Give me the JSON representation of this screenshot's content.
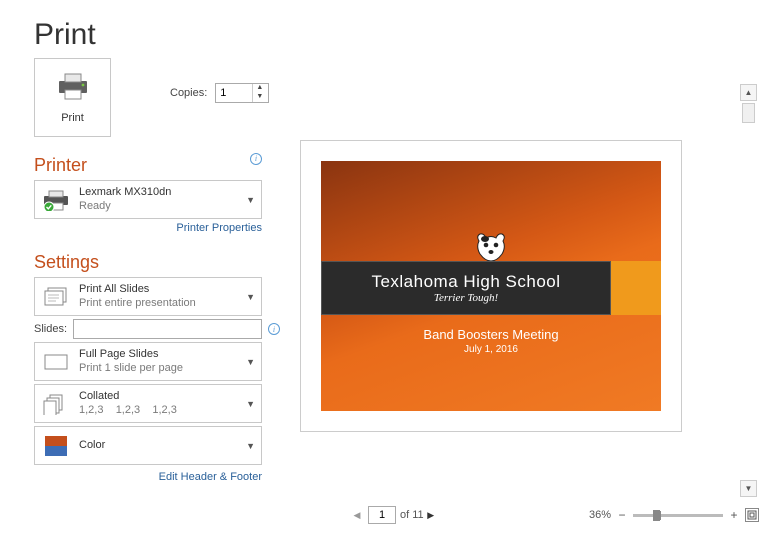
{
  "page_title": "Print",
  "print_tile": {
    "label": "Print"
  },
  "copies": {
    "label": "Copies:",
    "value": "1"
  },
  "sections": {
    "printer": "Printer",
    "settings": "Settings"
  },
  "printer": {
    "name": "Lexmark MX310dn",
    "status": "Ready",
    "properties_link": "Printer Properties"
  },
  "settings": {
    "what": {
      "main": "Print All Slides",
      "sub": "Print entire presentation"
    },
    "slides_label": "Slides:",
    "slides_value": "",
    "layout": {
      "main": "Full Page Slides",
      "sub": "Print 1 slide per page"
    },
    "collate": {
      "main": "Collated",
      "sub": "1,2,3    1,2,3    1,2,3"
    },
    "color": {
      "main": "Color"
    },
    "edit_link": "Edit Header & Footer"
  },
  "preview": {
    "school": "Texlahoma High School",
    "tagline": "Terrier Tough!",
    "subtitle": "Band Boosters Meeting",
    "date": "July 1, 2016"
  },
  "nav": {
    "page": "1",
    "of_label": "of 11",
    "zoom": "36%"
  }
}
